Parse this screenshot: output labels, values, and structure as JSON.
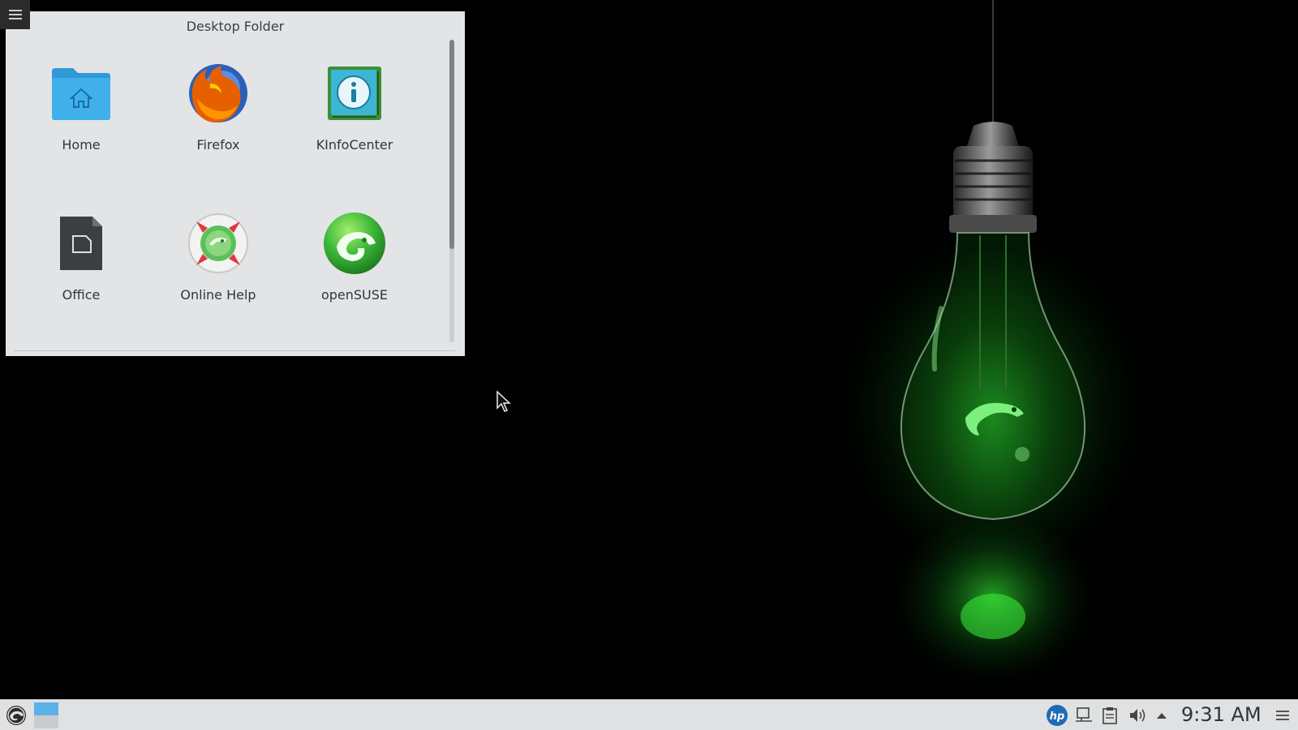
{
  "folder": {
    "title": "Desktop Folder",
    "items": [
      {
        "label": "Home",
        "icon": "home-folder-icon"
      },
      {
        "label": "Firefox",
        "icon": "firefox-icon"
      },
      {
        "label": "KInfoCenter",
        "icon": "kinfocenter-icon"
      },
      {
        "label": "Office",
        "icon": "office-document-icon"
      },
      {
        "label": "Online Help",
        "icon": "online-help-lifebuoy-icon"
      },
      {
        "label": "openSUSE",
        "icon": "opensuse-logo-icon"
      }
    ],
    "scroll_position": 0.0
  },
  "taskbar": {
    "clock": "9:31 AM",
    "tray_icons": [
      "hp-icon",
      "display-icon",
      "clipboard-icon",
      "volume-icon",
      "expand-tray-arrow-icon",
      "panel-menu-icon"
    ],
    "left_items": [
      "application-launcher-icon",
      "pager-desktop-icon"
    ]
  },
  "colors": {
    "desktop_bg": "#000000",
    "widget_bg": "#e3e4e6",
    "taskbar_bg": "#dfe1e3",
    "accent_green": "#44c23a",
    "text": "#31363b"
  }
}
